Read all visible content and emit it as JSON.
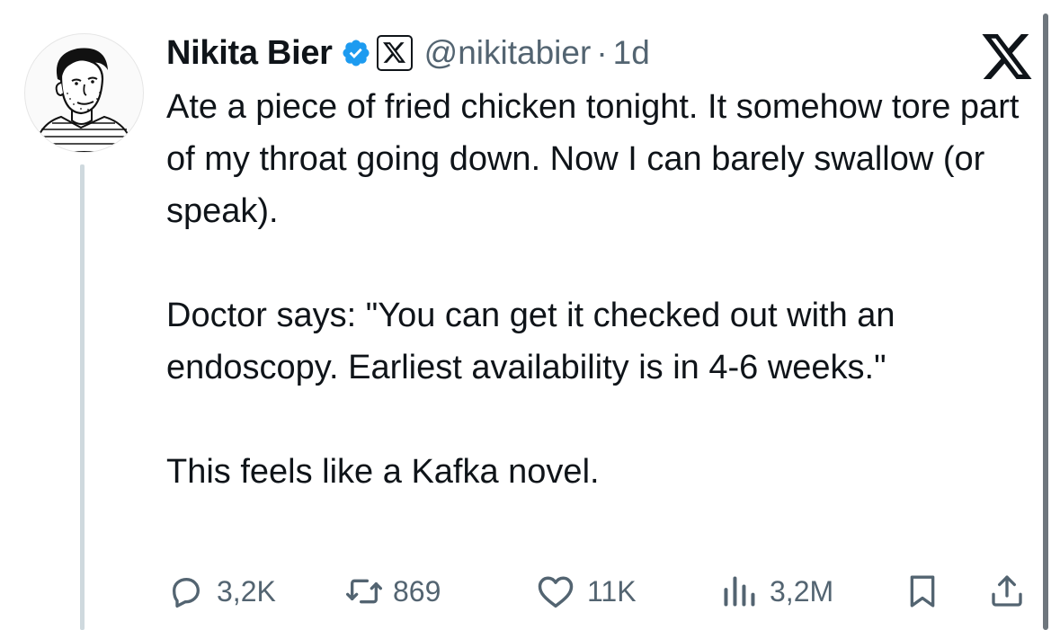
{
  "author": {
    "display_name": "Nikita Bier",
    "handle": "@nikitabier",
    "separator": "·",
    "time": "1d",
    "verified_icon": "verified-badge-icon",
    "affiliate_icon": "x-affiliate-badge-icon"
  },
  "tweet": {
    "paragraphs": [
      "Ate a piece of fried chicken tonight. It somehow tore part of my throat going down. Now I can barely swallow (or speak).",
      "Doctor says: \"You can get it checked out with an endoscopy. Earliest availability is in 4-6 weeks.\"",
      "This feels like a Kafka novel."
    ]
  },
  "actions": {
    "reply": {
      "icon": "reply-icon",
      "count": "3,2K"
    },
    "repost": {
      "icon": "repost-icon",
      "count": "869"
    },
    "like": {
      "icon": "heart-icon",
      "count": "11K"
    },
    "views": {
      "icon": "views-chart-icon",
      "count": "3,2M"
    },
    "bookmark": {
      "icon": "bookmark-icon"
    },
    "share": {
      "icon": "share-icon"
    }
  },
  "colors": {
    "text": "#0f1419",
    "secondary": "#536471",
    "verified": "#1d9bf0",
    "thread_line": "#cfd9de"
  }
}
